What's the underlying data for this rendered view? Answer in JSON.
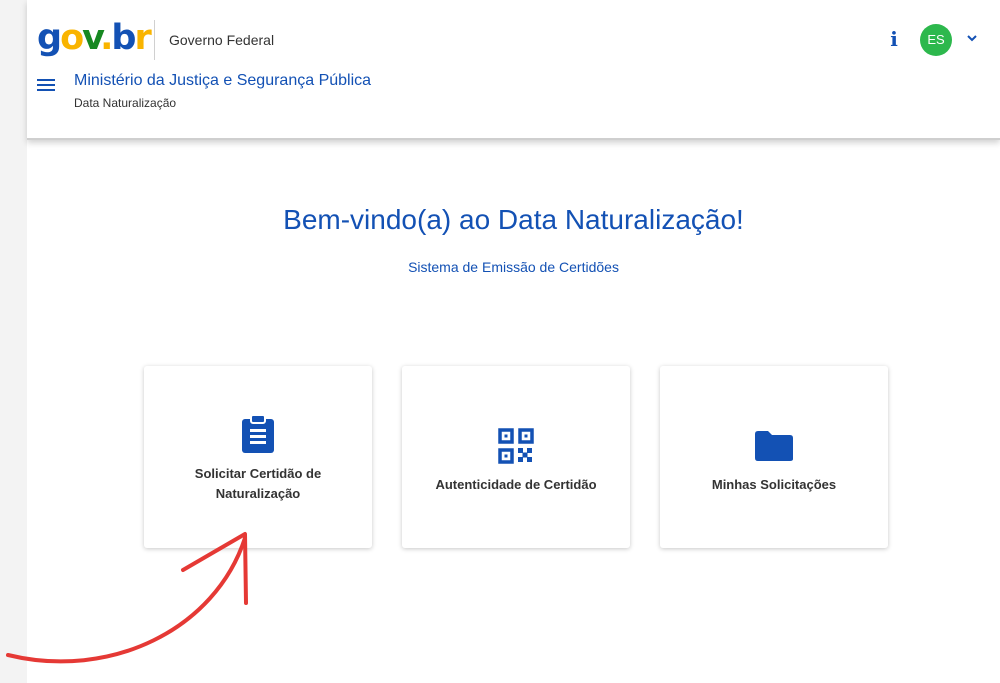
{
  "header": {
    "logo": {
      "g": "g",
      "o": "o",
      "v": "v",
      "dot": ".",
      "b": "b",
      "r": "r"
    },
    "gov_label": "Governo Federal",
    "ministry": "Ministério da Justiça e Segurança Pública",
    "system_name": "Data Naturalização",
    "info_icon": "i",
    "avatar_initials": "ES"
  },
  "welcome": {
    "title": "Bem-vindo(a) ao Data Naturalização!",
    "subtitle": "Sistema de Emissão de Certidões"
  },
  "cards": [
    {
      "label_line1": "Solicitar Certidão de",
      "label_line2": "Naturalização",
      "icon": "clipboard-list-icon"
    },
    {
      "label": "Autenticidade de Certidão",
      "icon": "qr-code-icon"
    },
    {
      "label": "Minhas Solicitações",
      "icon": "folder-icon"
    }
  ],
  "colors": {
    "primary_blue": "#1351b4",
    "avatar_green": "#2db84d",
    "logo_yellow": "#f9b400",
    "logo_green": "#168821",
    "annotation_red": "#e53935"
  },
  "icons": {
    "menu": "hamburger-menu-icon",
    "info": "info-icon",
    "chevron": "chevron-down-icon",
    "annotation": "red-arrow-icon"
  }
}
